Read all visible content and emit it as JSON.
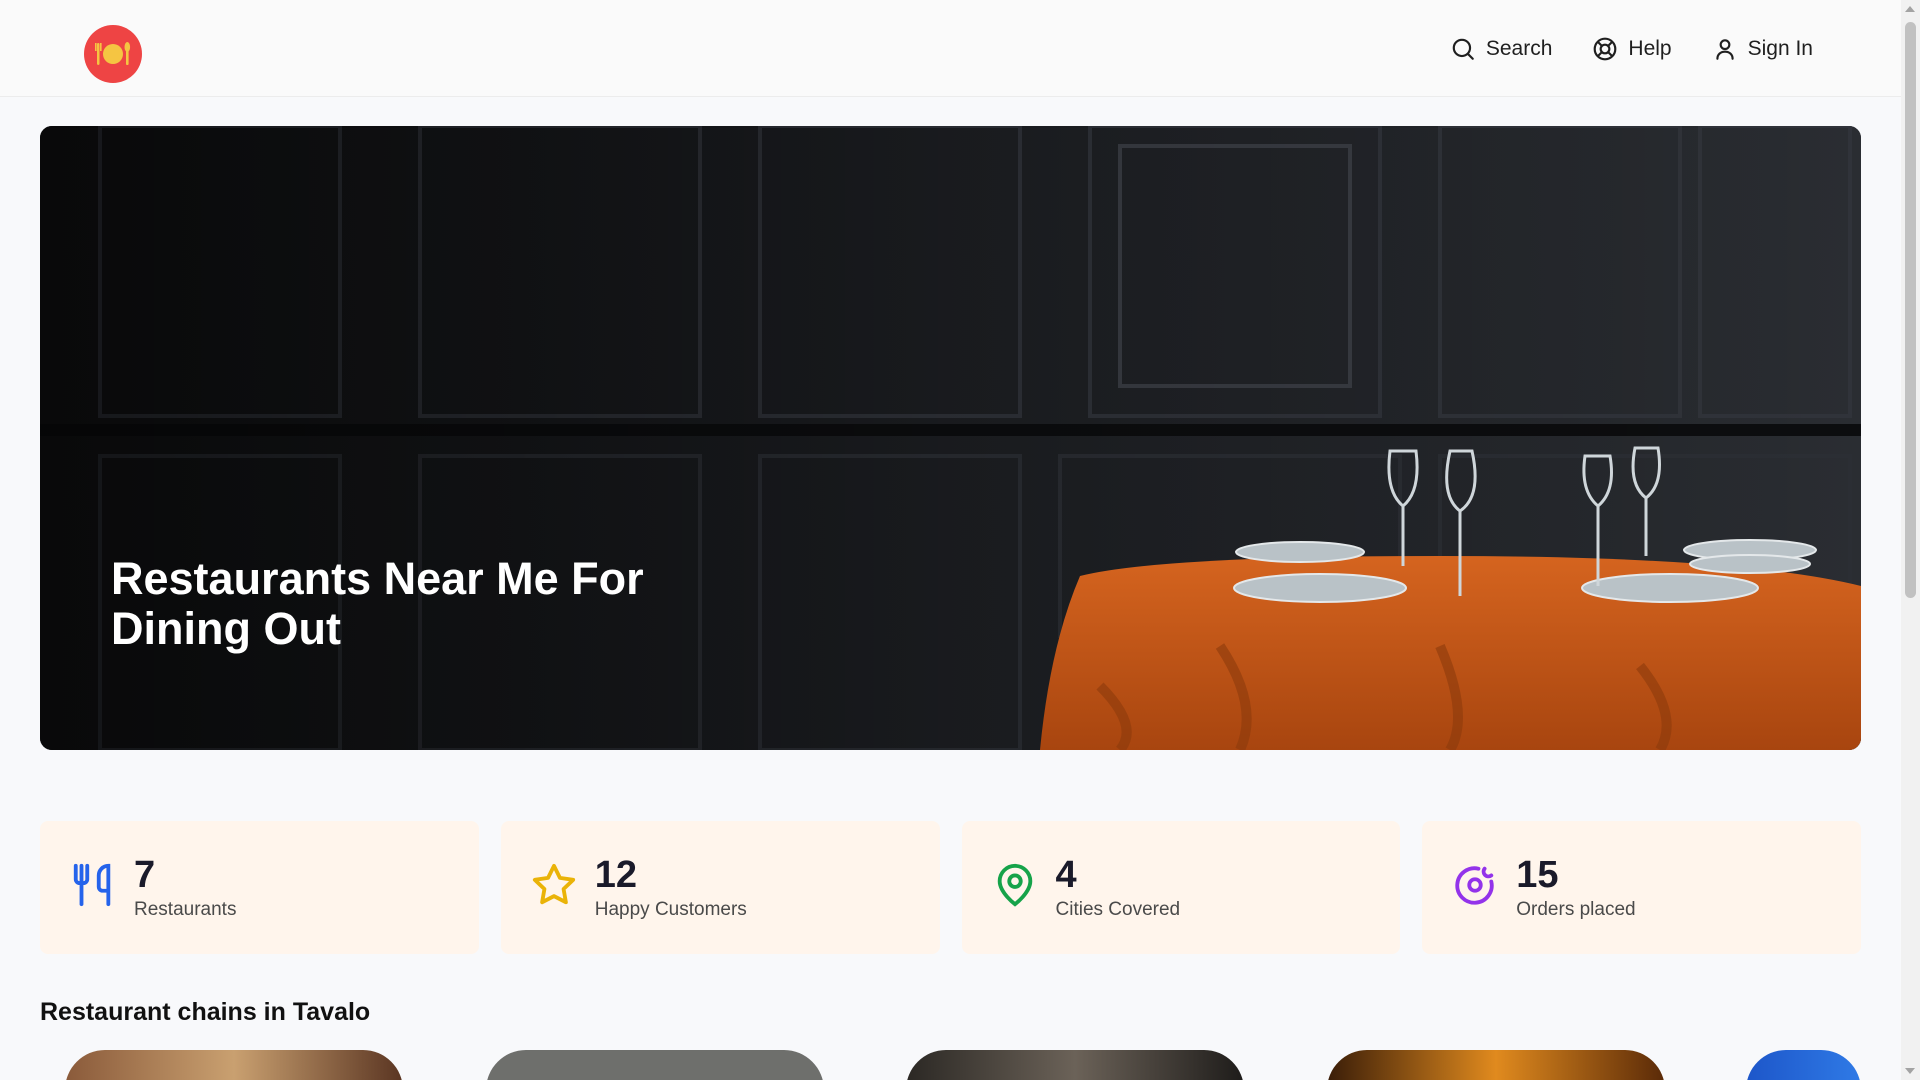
{
  "header": {
    "nav": [
      {
        "label": "Search",
        "icon": "search-icon"
      },
      {
        "label": "Help",
        "icon": "help-icon"
      },
      {
        "label": "Sign In",
        "icon": "user-icon"
      }
    ]
  },
  "hero": {
    "title": "Restaurants Near Me For Dining Out"
  },
  "stats": [
    {
      "value": "7",
      "label": "Restaurants",
      "icon": "utensils-icon",
      "color": "#2563eb"
    },
    {
      "value": "12",
      "label": "Happy Customers",
      "icon": "star-icon",
      "color": "#eab308"
    },
    {
      "value": "4",
      "label": "Cities Covered",
      "icon": "map-pin-icon",
      "color": "#16a34a"
    },
    {
      "value": "15",
      "label": "Orders placed",
      "icon": "donut-icon",
      "color": "#9333ea"
    }
  ],
  "chains": {
    "title": "Restaurant chains in Tavalo"
  },
  "colors": {
    "brand": "#ee4444",
    "card_bg": "#fff5ec"
  }
}
